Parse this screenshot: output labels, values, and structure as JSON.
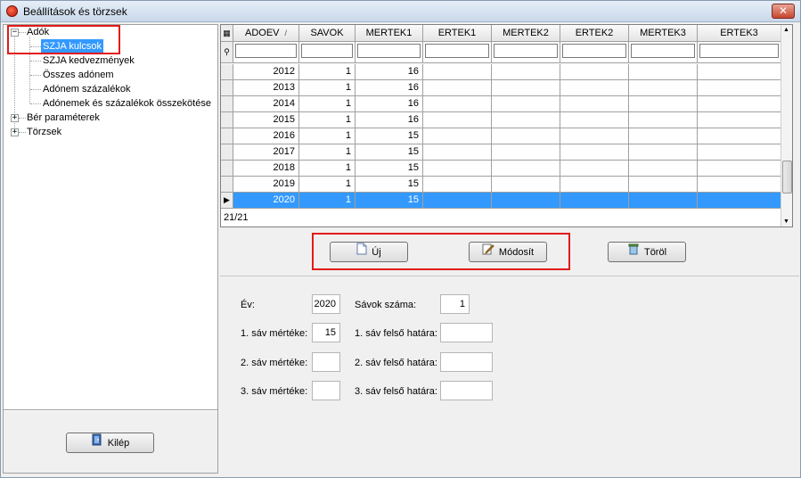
{
  "window": {
    "title": "Beállítások és törzsek"
  },
  "tree": {
    "nodes": [
      {
        "label": "Adók",
        "expander": "−"
      },
      {
        "label": "SZJA kulcsok"
      },
      {
        "label": "SZJA kedvezmények"
      },
      {
        "label": "Összes adónem"
      },
      {
        "label": "Adónem százalékok"
      },
      {
        "label": "Adónemek és százalékok összekötése"
      },
      {
        "label": "Bér paraméterek",
        "expander": "+"
      },
      {
        "label": "Törzsek",
        "expander": "+"
      }
    ]
  },
  "exit_button": {
    "label": "Kilép"
  },
  "grid": {
    "columns": [
      "ADOEV",
      "SAVOK",
      "MERTEK1",
      "ERTEK1",
      "MERTEK2",
      "ERTEK2",
      "MERTEK3",
      "ERTEK3"
    ],
    "sort_indicator": "/",
    "rows": [
      [
        "2012",
        "1",
        "16",
        "",
        "",
        "",
        "",
        ""
      ],
      [
        "2013",
        "1",
        "16",
        "",
        "",
        "",
        "",
        ""
      ],
      [
        "2014",
        "1",
        "16",
        "",
        "",
        "",
        "",
        ""
      ],
      [
        "2015",
        "1",
        "16",
        "",
        "",
        "",
        "",
        ""
      ],
      [
        "2016",
        "1",
        "15",
        "",
        "",
        "",
        "",
        ""
      ],
      [
        "2017",
        "1",
        "15",
        "",
        "",
        "",
        "",
        ""
      ],
      [
        "2018",
        "1",
        "15",
        "",
        "",
        "",
        "",
        ""
      ],
      [
        "2019",
        "1",
        "15",
        "",
        "",
        "",
        "",
        ""
      ],
      [
        "2020",
        "1",
        "15",
        "",
        "",
        "",
        "",
        ""
      ]
    ],
    "footer": "21/21"
  },
  "actions": {
    "new": "Új",
    "modify": "Módosít",
    "delete": "Töröl"
  },
  "form": {
    "year_label": "Év:",
    "year_value": "2020",
    "bands_label": "Sávok száma:",
    "bands_value": "1",
    "rate1_label": "1. sáv mértéke:",
    "rate1_value": "15",
    "upper1_label": "1. sáv felső határa:",
    "upper1_value": "",
    "rate2_label": "2. sáv mértéke:",
    "rate2_value": "",
    "upper2_label": "2. sáv felső határa:",
    "upper2_value": "",
    "rate3_label": "3. sáv mértéke:",
    "rate3_value": "",
    "upper3_label": "3. sáv felső határa:",
    "upper3_value": ""
  },
  "colors": {
    "selection": "#3399ff",
    "highlight": "#e21a1a"
  }
}
